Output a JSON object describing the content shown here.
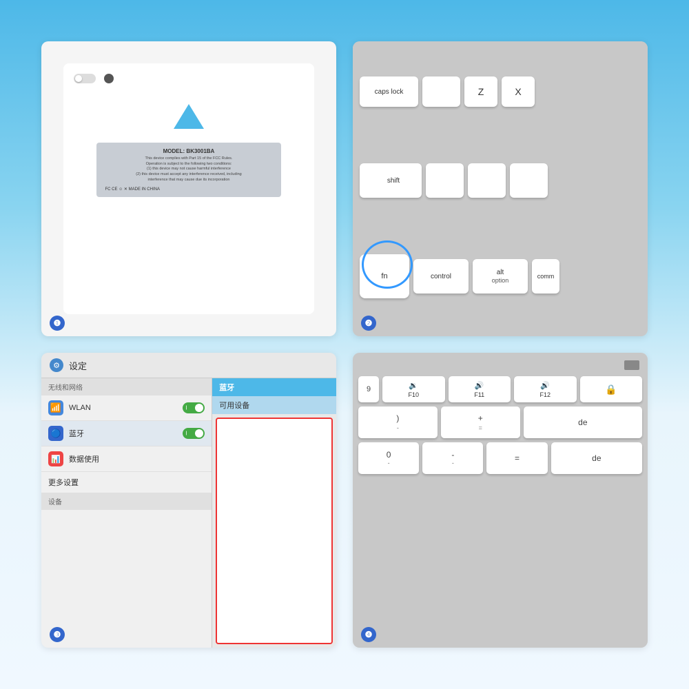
{
  "background": {
    "color_top": "#4db8e8",
    "color_bottom": "#c8eaf8"
  },
  "panel1": {
    "step": "❶",
    "model": "MODEL: BK3001BA",
    "desc_line1": "This device complies with Part 15 of the FCC Rules.",
    "desc_line2": "Operation is subject to the following two conditions:",
    "desc_line3": "(1) this device may not cause harmful interference",
    "desc_line4": "(2) this device must accept any interference received, including",
    "desc_line5": "interference that may cause due its incorporation",
    "certifications": "FC CE ☺ ✕   MADE IN CHINA"
  },
  "panel2": {
    "step": "❷",
    "keys": {
      "row1": [
        "caps lock",
        "",
        "Z",
        "X"
      ],
      "row2": [
        "shift",
        "",
        "",
        ""
      ],
      "row3": [
        "fn",
        "control",
        "alt\noption",
        "comm"
      ]
    }
  },
  "panel3": {
    "step": "❸",
    "header_title": "设定",
    "section1_label": "无线和网络",
    "wifi_label": "WLAN",
    "bt_label": "蓝牙",
    "data_label": "数据使用",
    "more_label": "更多设置",
    "section2_label": "设备",
    "bt_panel_title": "蓝牙",
    "available_title": "可用设备"
  },
  "panel4": {
    "step": "❹",
    "fkeys": [
      "F10",
      "F11",
      "F12"
    ],
    "fkey_icons": [
      "🔉",
      "🔊",
      "🔊"
    ],
    "numkeys_top": [
      ")",
      "+"
    ],
    "numkeys_sub": [
      "-",
      "="
    ],
    "numkeys_left": "9",
    "botkeys": [
      "0",
      "de"
    ],
    "botkeys_sub": [
      "-",
      ""
    ]
  }
}
